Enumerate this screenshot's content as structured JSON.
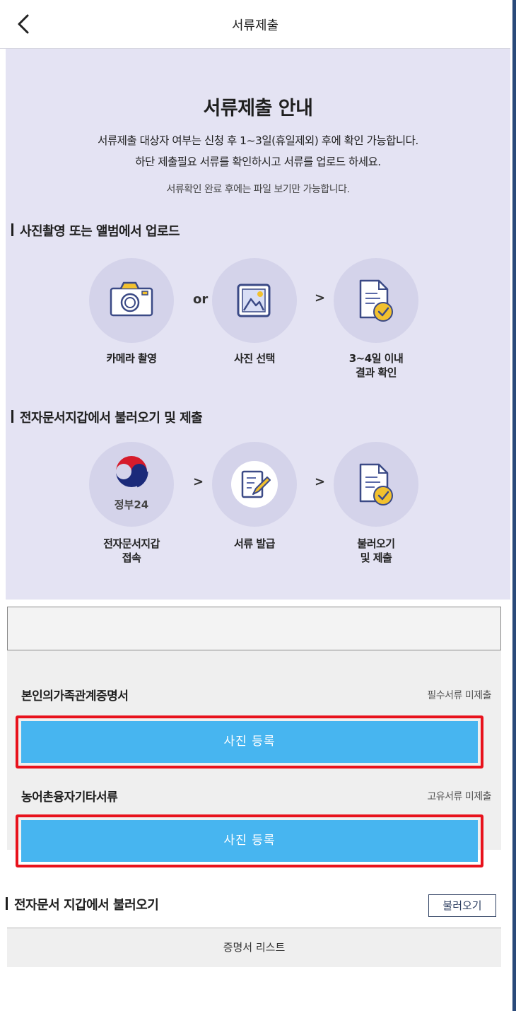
{
  "header": {
    "title": "서류제출"
  },
  "guide": {
    "title": "서류제출 안내",
    "desc_line1": "서류제출 대상자 여부는 신청 후 1~3일(휴일제외) 후에 확인 가능합니다.",
    "desc_line2": "하단 제출필요 서류를 확인하시고 서류를 업로드 하세요.",
    "note": "서류확인 완료 후에는 파일 보기만 가능합니다.",
    "section1": {
      "title": "사진촬영 또는 앨범에서 업로드",
      "steps": [
        {
          "label": "카메라 촬영",
          "icon": "camera-icon"
        },
        {
          "connector": "or"
        },
        {
          "label": "사진 선택",
          "icon": "image-icon"
        },
        {
          "connector": ">"
        },
        {
          "label_line1": "3~4일 이내",
          "label_line2": "결과 확인",
          "icon": "document-check-icon"
        }
      ]
    },
    "section2": {
      "title": "전자문서지갑에서 불러오기 및 제출",
      "steps": [
        {
          "label_line1": "전자문서지갑",
          "label_line2": "접속",
          "icon": "gov24-logo",
          "logo_text": "정부24"
        },
        {
          "connector": ">"
        },
        {
          "label": "서류 발급",
          "icon": "document-edit-icon"
        },
        {
          "connector": ">"
        },
        {
          "label_line1": "불러오기",
          "label_line2": "및 제출",
          "icon": "document-check-icon"
        }
      ]
    }
  },
  "documents": [
    {
      "name": "본인의가족관계증명서",
      "status": "필수서류 미제출",
      "button": "사진 등록"
    },
    {
      "name": "농어촌융자기타서류",
      "status": "고유서류 미제출",
      "button": "사진 등록"
    }
  ],
  "wallet": {
    "title": "전자문서 지갑에서 불러오기",
    "load_button": "불러오기",
    "list_tab": "증명서 리스트"
  },
  "colors": {
    "guide_bg": "#e4e3f3",
    "circle_bg": "#d4d3ea",
    "upload_button": "#47b5f0",
    "highlight": "#e8121c",
    "check_badge": "#f2c12e",
    "icon_blue": "#3b4a86"
  }
}
